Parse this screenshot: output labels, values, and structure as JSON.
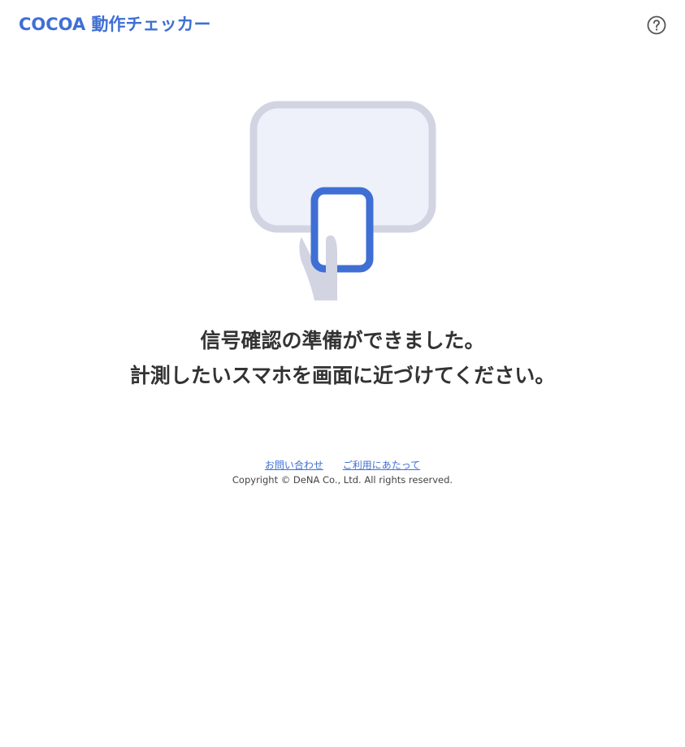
{
  "header": {
    "title": "COCOA 動作チェッカー",
    "help_icon": "question-circle-icon"
  },
  "illustration": {
    "icon": "phone-to-screen-icon",
    "colors": {
      "screen_fill": "#eef1fa",
      "screen_border": "#d2d4e2",
      "phone_border": "#3f6fd4",
      "hand": "#d2d4e2"
    }
  },
  "main": {
    "message_line1": "信号確認の準備ができました。",
    "message_line2": "計測したいスマホを画面に近づけてください。"
  },
  "footer": {
    "links": [
      {
        "label": "お問い合わせ"
      },
      {
        "label": "ご利用にあたって"
      }
    ],
    "copyright": "Copyright © DeNA Co., Ltd. All rights reserved."
  },
  "colors": {
    "accent": "#3f6fd4",
    "text": "#333333"
  }
}
